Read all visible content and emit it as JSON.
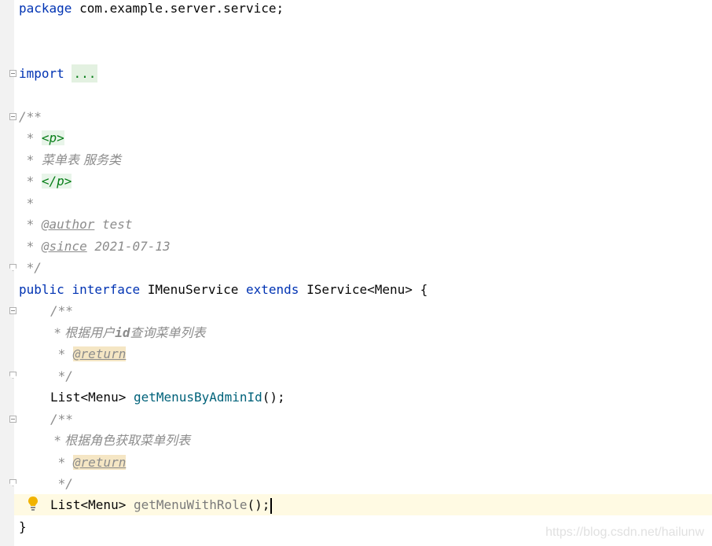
{
  "editor": {
    "lines": {
      "package_kw": "package",
      "package_name": " com.example.server.service;",
      "import_kw": "import",
      "import_fold": "...",
      "jd_open": "/**",
      "star": " * ",
      "p_open": "<p>",
      "menu_desc": "菜单表 服务类",
      "p_close": "</p>",
      "star_only": " *",
      "author_tag": "@author",
      "author_val": " test",
      "since_tag": "@since",
      "since_val": " 2021-07-13",
      "jd_close": " */",
      "public_kw": "public",
      "interface_kw": "interface",
      "iface_name": " IMenuService ",
      "extends_kw": "extends",
      "iface_rest": " IService<Menu> {",
      "m1_open": "/**",
      "m1_desc_pre": " * 根据用户",
      "m1_desc_id": "id",
      "m1_desc_post": "查询菜单列表",
      "m1_ret_pre": " * ",
      "return_tag": "@return",
      "m1_close": " */",
      "m1_type": "List<Menu> ",
      "m1_name": "getMenusByAdminId",
      "m1_tail": "();",
      "m2_open": "/**",
      "m2_desc": " * 根据角色获取菜单列表",
      "m2_ret_pre": " * ",
      "m2_close": " */",
      "m2_type": "List<Menu> ",
      "m2_name": "getMenuWithRole",
      "m2_tail": "();",
      "close_brace": "}"
    }
  },
  "watermark": "https://blog.csdn.net/hailunw",
  "colors": {
    "keyword": "#0033b3",
    "comment": "#8c8c8c",
    "method": "#00627a",
    "current_line": "#fffae3"
  }
}
